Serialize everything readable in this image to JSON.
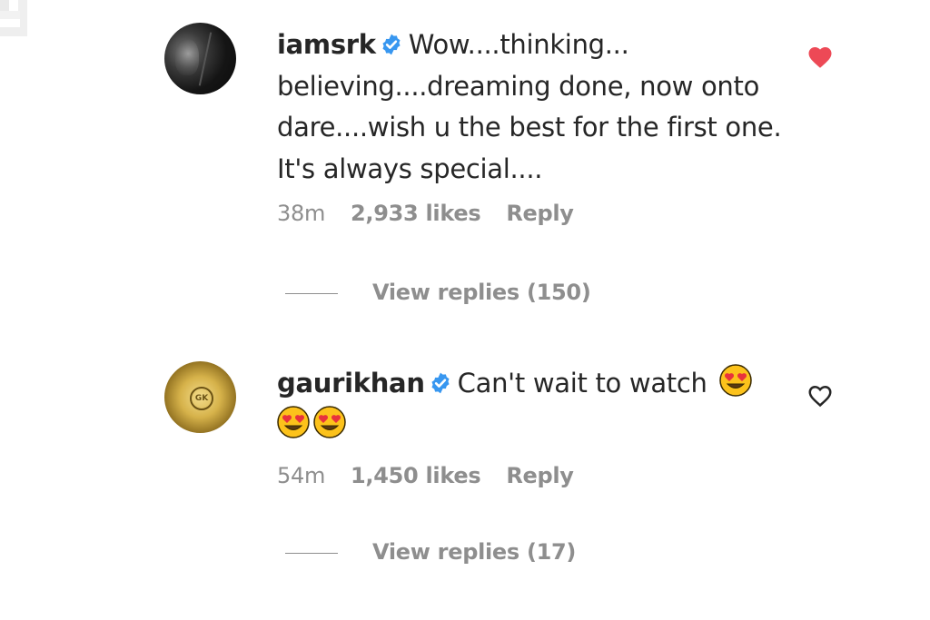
{
  "comments": [
    {
      "username": "iamsrk",
      "verified": true,
      "text": "Wow....thinking... believing....dreaming done, now onto dare....wish u the best for the first one. It's always special....",
      "time": "38m",
      "likes": "2,933 likes",
      "reply_label": "Reply",
      "view_replies": "View replies (150)",
      "liked": true,
      "avatar_icon": "avatar-photo-icon"
    },
    {
      "username": "gaurikhan",
      "verified": true,
      "text": "Can't wait to watch",
      "emoji": "heart-eyes-emoji",
      "emoji_count": 3,
      "time": "54m",
      "likes": "1,450 likes",
      "reply_label": "Reply",
      "view_replies": "View replies (17)",
      "liked": false,
      "avatar_icon": "avatar-logo-icon"
    }
  ],
  "colors": {
    "text": "#262626",
    "secondary": "#8e8e8e",
    "verified_blue": "#3897f0",
    "like_red": "#ed4956"
  }
}
